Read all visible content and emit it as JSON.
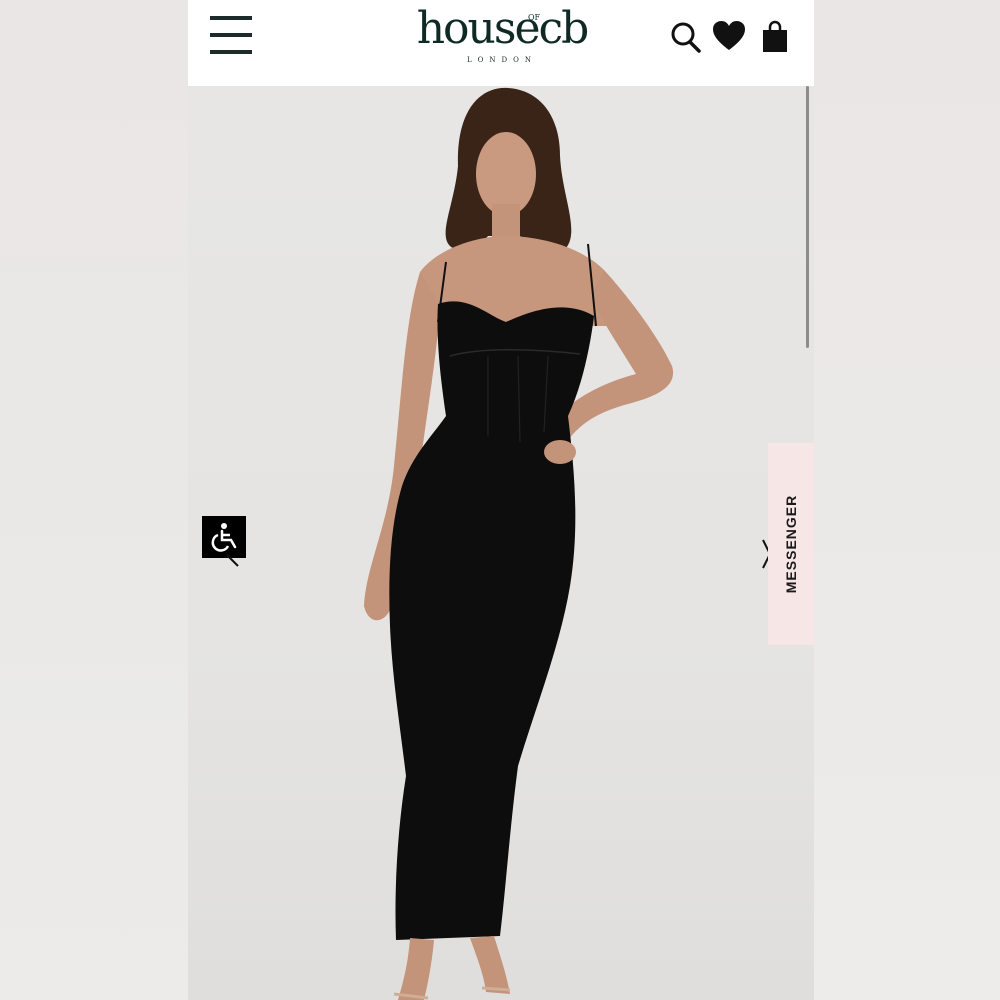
{
  "header": {
    "menu_icon": "hamburger-menu-icon",
    "logo_text": "housecb",
    "logo_of": "OF",
    "logo_subtitle": "LONDON",
    "icons": [
      "search-icon",
      "heart-icon",
      "shopping-bag-icon"
    ]
  },
  "product_image": {
    "subject": "model-in-black-corset-maxi-dress"
  },
  "overlays": {
    "accessibility_icon": "wheelchair-accessibility-icon",
    "carousel_icon": "chevron-right-icon",
    "messenger_label": "MESSENGER"
  },
  "colors": {
    "brand": "#0f2a24",
    "messenger_tab": "#f7e6e6",
    "dress": "#0d0d0d"
  }
}
